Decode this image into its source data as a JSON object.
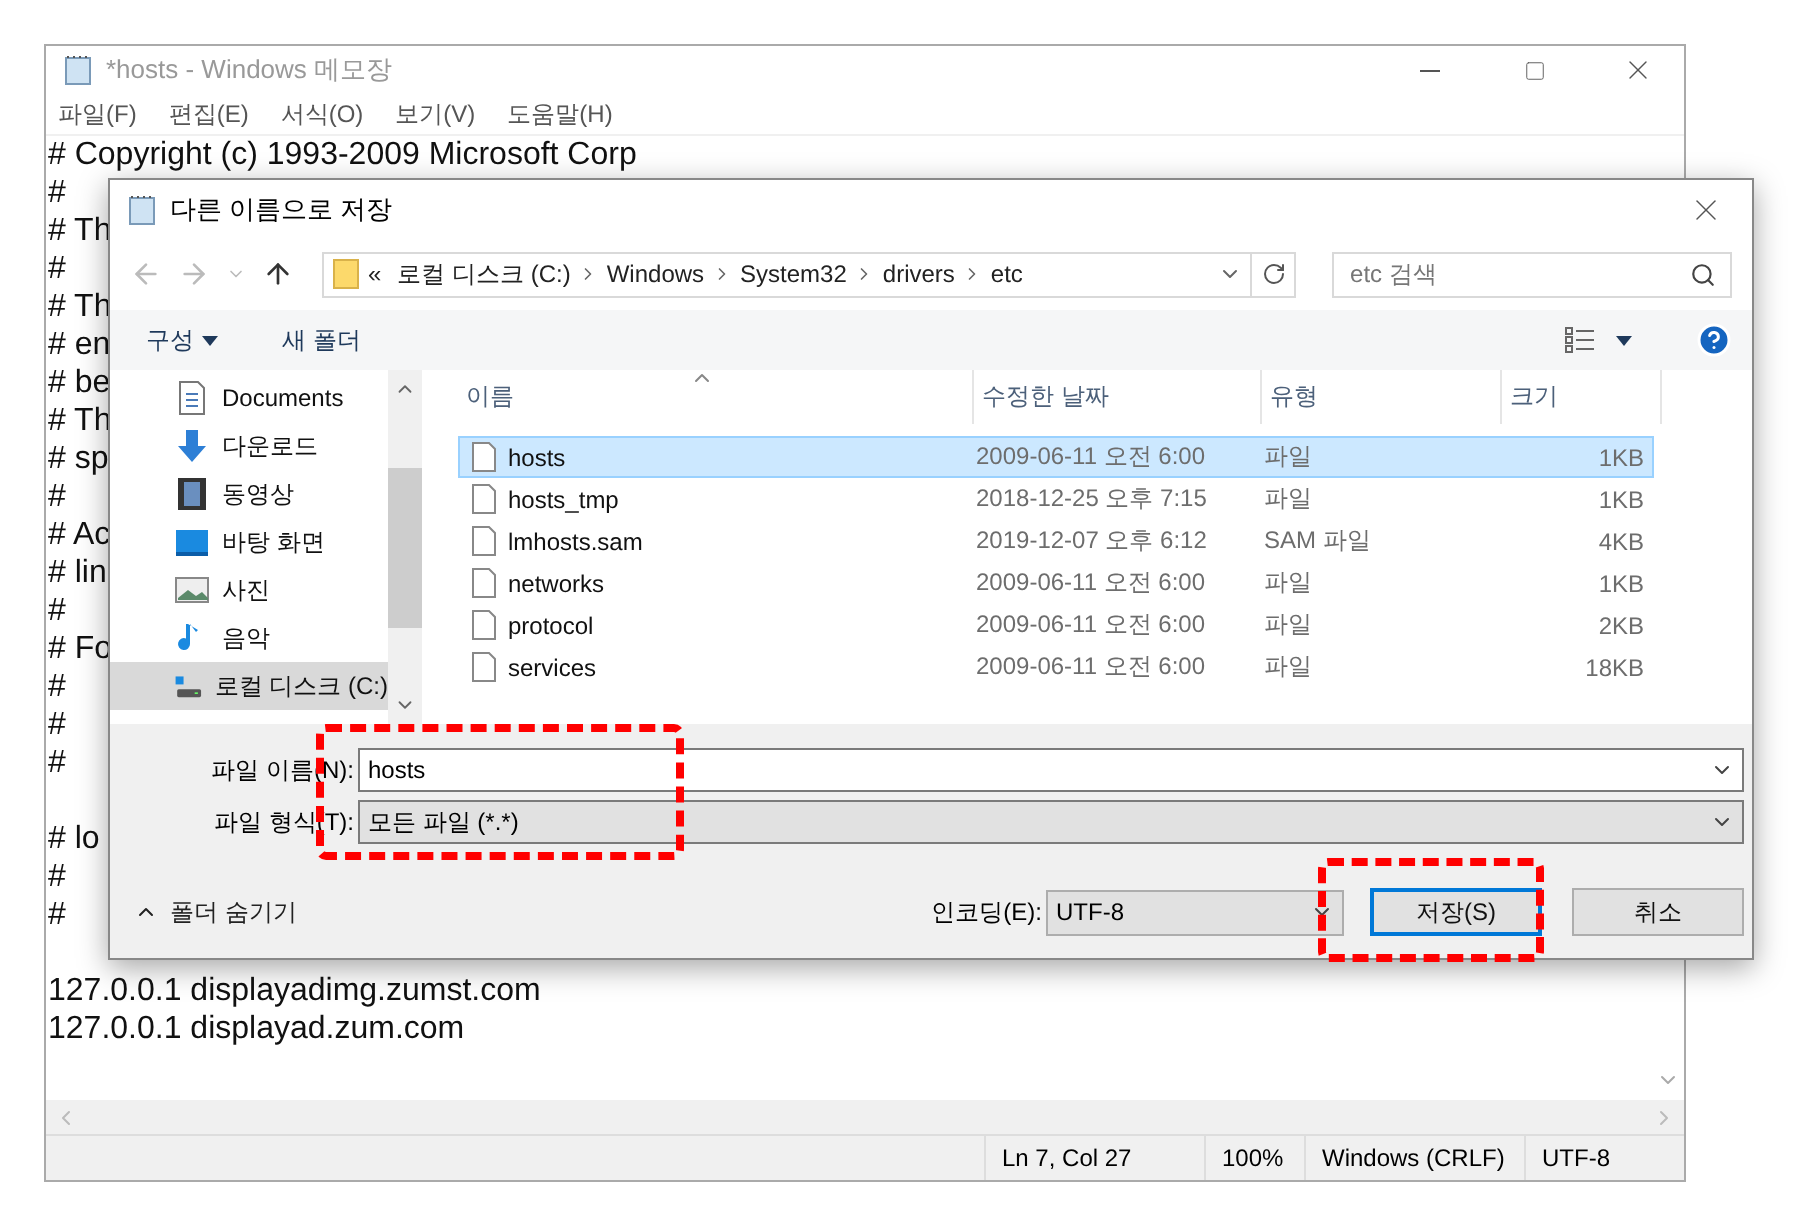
{
  "notepad": {
    "title": "*hosts - Windows 메모장",
    "menu": [
      "파일(F)",
      "편집(E)",
      "서식(O)",
      "보기(V)",
      "도움말(H)"
    ],
    "blocks": [
      [
        "# Copyright (c) 1993-2009 Microsoft Corp",
        "#",
        "# Th",
        "#",
        "# Th",
        "# en",
        "# be",
        "# Th",
        "# sp",
        "#",
        "# Ac",
        "# lin",
        "#",
        "# Fo",
        "#",
        "#",
        "#"
      ],
      [
        "# lo",
        "#",
        "#"
      ],
      [
        "127.0.0.1 displayadimg.zumst.com",
        "127.0.0.1 displayad.zum.com"
      ]
    ],
    "status": [
      "Ln 7, Col 27",
      "100%",
      "Windows (CRLF)",
      "UTF-8"
    ]
  },
  "dialog": {
    "title": "다른 이름으로 저장",
    "address": {
      "overflow": "«",
      "segments": [
        "로컬 디스크 (C:)",
        "Windows",
        "System32",
        "drivers",
        "etc"
      ]
    },
    "search": {
      "placeholder": "etc 검색"
    },
    "toolbar": {
      "organize": "구성",
      "new_folder": "새 폴더"
    },
    "nav": [
      {
        "label": "Documents",
        "kind": "documents",
        "selected": false
      },
      {
        "label": "다운로드",
        "kind": "download",
        "selected": false
      },
      {
        "label": "동영상",
        "kind": "video",
        "selected": false
      },
      {
        "label": "바탕 화면",
        "kind": "desktop",
        "selected": false
      },
      {
        "label": "사진",
        "kind": "pictures",
        "selected": false
      },
      {
        "label": "음악",
        "kind": "music",
        "selected": false
      },
      {
        "label": "로컬 디스크 (C:)",
        "kind": "drive",
        "selected": true
      }
    ],
    "columns": [
      "이름",
      "수정한 날짜",
      "유형",
      "크기"
    ],
    "files": [
      {
        "name": "hosts",
        "date": "2009-06-11 오전 6:00",
        "type": "파일",
        "size": "1KB",
        "selected": true
      },
      {
        "name": "hosts_tmp",
        "date": "2018-12-25 오후 7:15",
        "type": "파일",
        "size": "1KB",
        "selected": false
      },
      {
        "name": "lmhosts.sam",
        "date": "2019-12-07 오후 6:12",
        "type": "SAM 파일",
        "size": "4KB",
        "selected": false
      },
      {
        "name": "networks",
        "date": "2009-06-11 오전 6:00",
        "type": "파일",
        "size": "1KB",
        "selected": false
      },
      {
        "name": "protocol",
        "date": "2009-06-11 오전 6:00",
        "type": "파일",
        "size": "2KB",
        "selected": false
      },
      {
        "name": "services",
        "date": "2009-06-11 오전 6:00",
        "type": "파일",
        "size": "18KB",
        "selected": false
      }
    ],
    "filename": {
      "label": "파일 이름(N):",
      "value": "hosts"
    },
    "filetype": {
      "label": "파일 형식(T):",
      "value": "모든 파일 (*.*)"
    },
    "hide_folders": "폴더 숨기기",
    "encoding": {
      "label": "인코딩(E):",
      "value": "UTF-8"
    },
    "buttons": [
      {
        "label": "저장(S)",
        "default": true
      },
      {
        "label": "취소",
        "default": false
      }
    ]
  }
}
